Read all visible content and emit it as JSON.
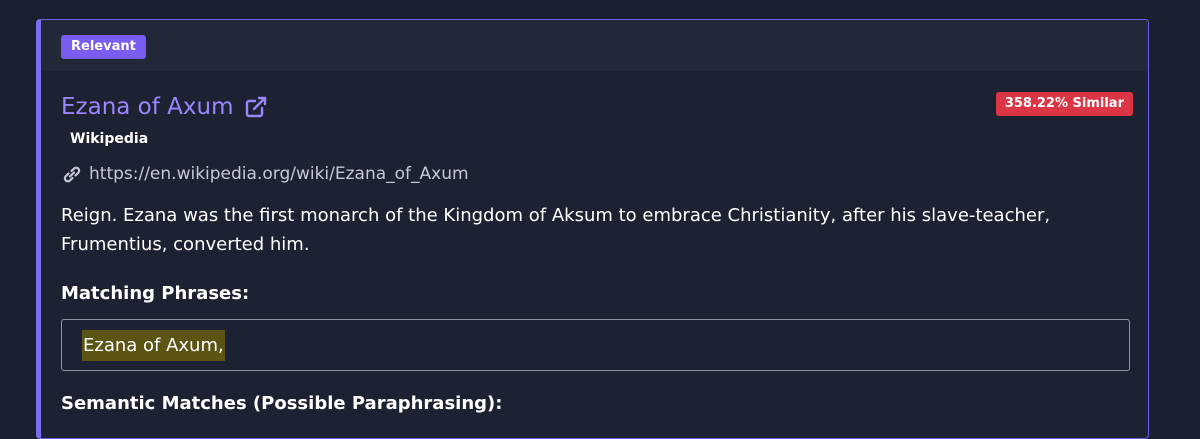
{
  "result": {
    "relevance_badge": "Relevant",
    "title": "Ezana of Axum",
    "similarity_badge": "358.22% Similar",
    "source": "Wikipedia",
    "url": "https://en.wikipedia.org/wiki/Ezana_of_Axum",
    "snippet": "Reign. Ezana was the first monarch of the Kingdom of Aksum to embrace Christianity, after his slave-teacher, Frumentius, converted him.",
    "matching_phrases_heading": "Matching Phrases:",
    "matching_phrases": [
      "Ezana of Axum,"
    ],
    "semantic_matches_heading": "Semantic Matches (Possible Paraphrasing):"
  },
  "colors": {
    "accent": "#7b5cf0",
    "title": "#9a86ff",
    "similarity": "#dc3545",
    "highlight": "#5c5414",
    "background": "#1b2030"
  },
  "icons": {
    "external": "external-link-icon",
    "link": "link-icon"
  }
}
